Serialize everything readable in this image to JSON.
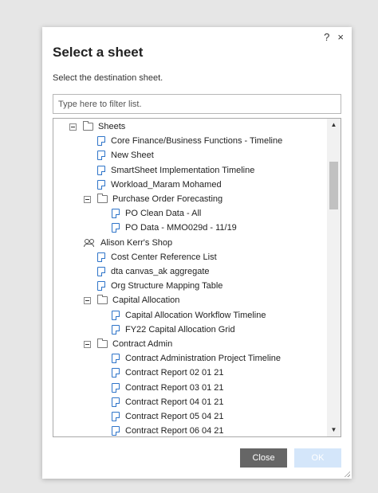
{
  "dialog": {
    "title": "Select a sheet",
    "subtitle": "Select the destination sheet.",
    "help_label": "?",
    "close_label": "×"
  },
  "filter": {
    "placeholder": "Type here to filter list.",
    "value": ""
  },
  "tree": {
    "rows": [
      {
        "label": "Sheets",
        "type": "folder",
        "depth": 0,
        "toggle": true
      },
      {
        "label": "Core Finance/Business Functions - Timeline",
        "type": "sheet",
        "depth": 1
      },
      {
        "label": "New Sheet",
        "type": "sheet",
        "depth": 1
      },
      {
        "label": "SmartSheet Implementation Timeline",
        "type": "sheet",
        "depth": 1
      },
      {
        "label": "Workload_Maram Mohamed",
        "type": "sheet",
        "depth": 1
      },
      {
        "label": "Purchase Order Forecasting",
        "type": "folder",
        "depth": 1,
        "toggle": true
      },
      {
        "label": "PO Clean Data - All",
        "type": "sheet",
        "depth": 2
      },
      {
        "label": "PO Data - MMO029d - 11/19",
        "type": "sheet",
        "depth": 2
      },
      {
        "label": "Alison Kerr's Shop",
        "type": "workspace",
        "depth": 0
      },
      {
        "label": "Cost Center Reference List",
        "type": "sheet",
        "depth": 1
      },
      {
        "label": "dta canvas_ak aggregate",
        "type": "sheet",
        "depth": 1
      },
      {
        "label": "Org Structure Mapping Table",
        "type": "sheet",
        "depth": 1
      },
      {
        "label": "Capital Allocation",
        "type": "folder",
        "depth": 1,
        "toggle": true
      },
      {
        "label": "Capital Allocation Workflow Timeline",
        "type": "sheet",
        "depth": 2
      },
      {
        "label": "FY22 Capital Allocation Grid",
        "type": "sheet",
        "depth": 2
      },
      {
        "label": "Contract Admin",
        "type": "folder",
        "depth": 1,
        "toggle": true
      },
      {
        "label": "Contract Administration Project Timeline",
        "type": "sheet",
        "depth": 2
      },
      {
        "label": "Contract Report 02 01 21",
        "type": "sheet",
        "depth": 2
      },
      {
        "label": "Contract Report 03 01 21",
        "type": "sheet",
        "depth": 2
      },
      {
        "label": "Contract Report 04 01 21",
        "type": "sheet",
        "depth": 2
      },
      {
        "label": "Contract Report 05 04 21",
        "type": "sheet",
        "depth": 2
      },
      {
        "label": "Contract Report 06 04 21",
        "type": "sheet",
        "depth": 2
      }
    ]
  },
  "buttons": {
    "close_label": "Close",
    "ok_label": "OK"
  },
  "colors": {
    "close_bg": "#666666",
    "ok_bg_disabled": "#d4e6fa",
    "sheet_icon": "#2e74c9"
  },
  "icons": {
    "folder": "folder-icon",
    "sheet": "sheet-icon",
    "workspace": "people-icon",
    "collapse": "collapse-toggle-icon"
  }
}
